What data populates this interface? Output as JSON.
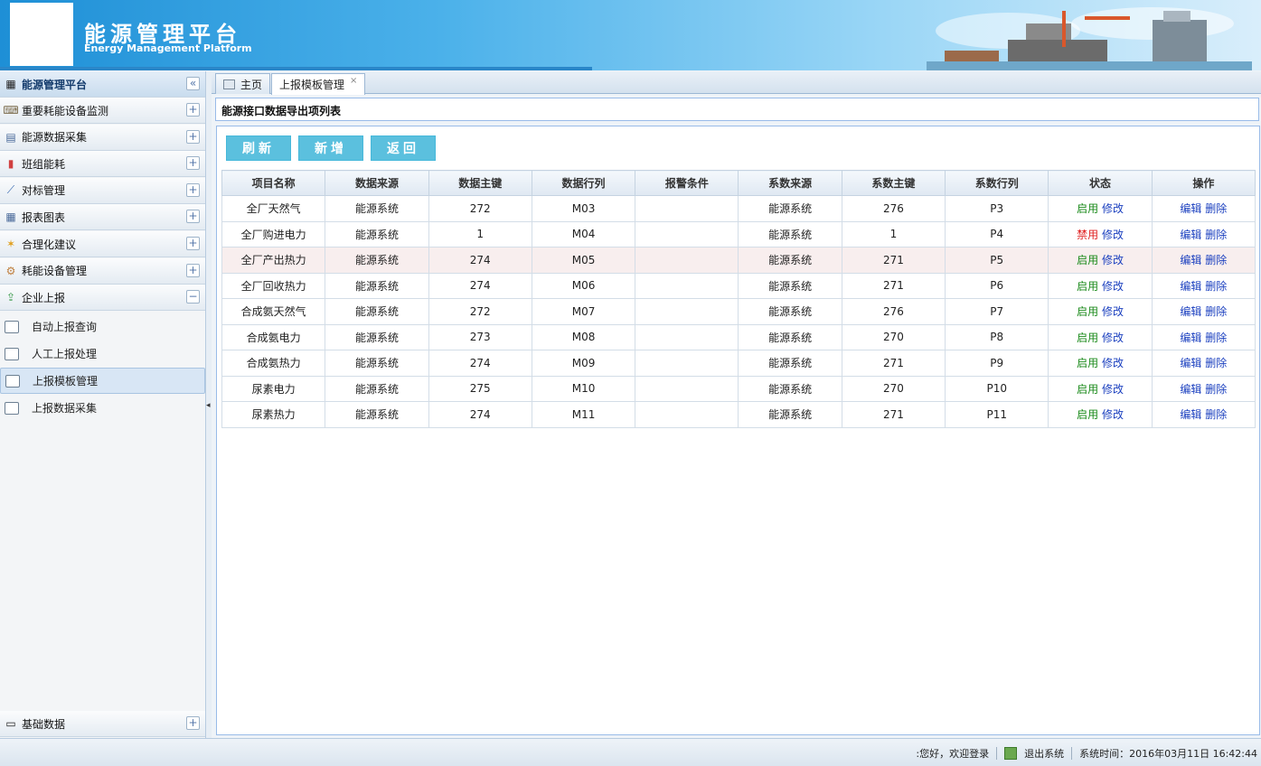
{
  "header": {
    "title": "能源管理平台",
    "subtitle": "Energy Management Platform"
  },
  "sidebar": {
    "top": {
      "label": "能源管理平台",
      "toggle": "«"
    },
    "groups": [
      {
        "label": "重要耗能设备监测",
        "icon": "monitor-icon",
        "toggle": "+"
      },
      {
        "label": "能源数据采集",
        "icon": "data-icon",
        "toggle": "+"
      },
      {
        "label": "班组能耗",
        "icon": "bar-chart-icon",
        "toggle": "+"
      },
      {
        "label": "对标管理",
        "icon": "line-chart-icon",
        "toggle": "+"
      },
      {
        "label": "报表图表",
        "icon": "report-icon",
        "toggle": "+"
      },
      {
        "label": "合理化建议",
        "icon": "star-icon",
        "toggle": "+"
      },
      {
        "label": "耗能设备管理",
        "icon": "gear-icon",
        "toggle": "+"
      },
      {
        "label": "企业上报",
        "icon": "upload-icon",
        "toggle": "−"
      }
    ],
    "subitems": [
      {
        "label": "自动上报查询"
      },
      {
        "label": "人工上报处理"
      },
      {
        "label": "上报模板管理"
      },
      {
        "label": "上报数据采集"
      }
    ],
    "bottom": {
      "label": "基础数据",
      "toggle": "+"
    }
  },
  "tabs": [
    {
      "label": "主页"
    },
    {
      "label": "上报模板管理",
      "close": "×"
    }
  ],
  "page_title": "能源接口数据导出项列表",
  "toolbar": {
    "refresh": "刷新",
    "add": "新增",
    "back": "返回"
  },
  "table": {
    "headers": [
      "项目名称",
      "数据来源",
      "数据主键",
      "数据行列",
      "报警条件",
      "系数来源",
      "系数主键",
      "系数行列",
      "状态",
      "操作"
    ],
    "rows": [
      {
        "name": "全厂天然气",
        "src": "能源系统",
        "key": "272",
        "rc": "M03",
        "alarm": "",
        "csrc": "能源系统",
        "ckey": "276",
        "crc": "P3",
        "status": "启用",
        "status_on": true,
        "modify": "修改",
        "edit": "编辑",
        "del": "删除"
      },
      {
        "name": "全厂购进电力",
        "src": "能源系统",
        "key": "1",
        "rc": "M04",
        "alarm": "",
        "csrc": "能源系统",
        "ckey": "1",
        "crc": "P4",
        "status": "禁用",
        "status_on": false,
        "modify": "修改",
        "edit": "编辑",
        "del": "删除"
      },
      {
        "name": "全厂产出热力",
        "src": "能源系统",
        "key": "274",
        "rc": "M05",
        "alarm": "",
        "csrc": "能源系统",
        "ckey": "271",
        "crc": "P5",
        "status": "启用",
        "status_on": true,
        "modify": "修改",
        "edit": "编辑",
        "del": "删除"
      },
      {
        "name": "全厂回收热力",
        "src": "能源系统",
        "key": "274",
        "rc": "M06",
        "alarm": "",
        "csrc": "能源系统",
        "ckey": "271",
        "crc": "P6",
        "status": "启用",
        "status_on": true,
        "modify": "修改",
        "edit": "编辑",
        "del": "删除"
      },
      {
        "name": "合成氨天然气",
        "src": "能源系统",
        "key": "272",
        "rc": "M07",
        "alarm": "",
        "csrc": "能源系统",
        "ckey": "276",
        "crc": "P7",
        "status": "启用",
        "status_on": true,
        "modify": "修改",
        "edit": "编辑",
        "del": "删除"
      },
      {
        "name": "合成氨电力",
        "src": "能源系统",
        "key": "273",
        "rc": "M08",
        "alarm": "",
        "csrc": "能源系统",
        "ckey": "270",
        "crc": "P8",
        "status": "启用",
        "status_on": true,
        "modify": "修改",
        "edit": "编辑",
        "del": "删除"
      },
      {
        "name": "合成氨热力",
        "src": "能源系统",
        "key": "274",
        "rc": "M09",
        "alarm": "",
        "csrc": "能源系统",
        "ckey": "271",
        "crc": "P9",
        "status": "启用",
        "status_on": true,
        "modify": "修改",
        "edit": "编辑",
        "del": "删除"
      },
      {
        "name": "尿素电力",
        "src": "能源系统",
        "key": "275",
        "rc": "M10",
        "alarm": "",
        "csrc": "能源系统",
        "ckey": "270",
        "crc": "P10",
        "status": "启用",
        "status_on": true,
        "modify": "修改",
        "edit": "编辑",
        "del": "删除"
      },
      {
        "name": "尿素热力",
        "src": "能源系统",
        "key": "274",
        "rc": "M11",
        "alarm": "",
        "csrc": "能源系统",
        "ckey": "271",
        "crc": "P11",
        "status": "启用",
        "status_on": true,
        "modify": "修改",
        "edit": "编辑",
        "del": "删除"
      }
    ]
  },
  "footer": {
    "greeting": ":您好，欢迎登录",
    "logout": "退出系统",
    "time_label": "系统时间：",
    "time": "2016年03月11日 16:42:44"
  },
  "colors": {
    "accent": "#5bc0de",
    "enabled": "#1a8a1a",
    "disabled": "#e02020",
    "link": "#1a3fbf"
  }
}
